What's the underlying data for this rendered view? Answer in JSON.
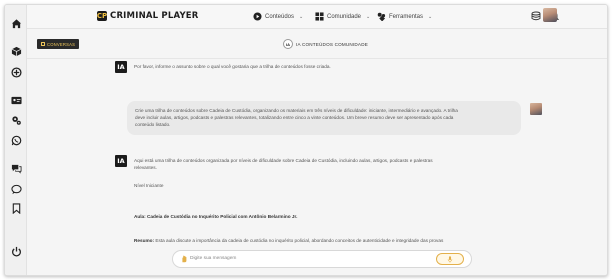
{
  "app": {
    "logo_text": "CRIMINAL PLAYER",
    "logo_mark": "CP"
  },
  "colors": {
    "accent": "#e3b04a",
    "dark": "#1b1b1b",
    "background": "#f5f5f5",
    "bubble": "#e9e9e9"
  },
  "topbar": {
    "nav": [
      {
        "label": "Conteúdos",
        "icon": "play-circle-icon"
      },
      {
        "label": "Comunidade",
        "icon": "grid-icon"
      },
      {
        "label": "Ferramentas",
        "icon": "tools-icon"
      }
    ],
    "icons": [
      "database-icon",
      "bell-icon"
    ]
  },
  "sidebar": {
    "icons": [
      "home-icon",
      "cube-icon",
      "layers-icon",
      "id-card-icon",
      "settings-icon",
      "whatsapp-icon",
      "chat-bubbles-icon",
      "comment-icon",
      "bookmark-icon",
      "power-icon"
    ]
  },
  "subbar": {
    "conversas_label": "CONVERSAS",
    "ia_badge": "IA",
    "title": "IA CONTEÚDOS COMUNIDADE"
  },
  "chat": {
    "ia_avatar": "IA",
    "ia_prompt": "Por favor, informe o assunto sobre o qual você gostaria que a trilha de conteúdos fosse criada.",
    "user_message_line1": "Crie uma trilha de conteúdos sobre Cadeia de Custódia, organizando os materiais em três níveis de dificuldade: iniciante, intermediário e avançado. A trilha",
    "user_message_line2": "deve incluir aulas, artigos, podcasts e palestras relevantes, totalizando entre cinco a vinte conteúdos. Um breve resumo deve ser apresentado após cada",
    "user_message_line3": "conteúdo listado.",
    "ia_reply_line1": "Aqui está uma trilha de conteúdos organizada por níveis de dificuldade sobre Cadeia de Custódia, incluindo aulas, artigos, podcasts e palestras",
    "ia_reply_line2": "relevantes.",
    "level_label": "Nível Iniciante",
    "aula_label": "Aula: Cadeia de Custódia no Inquérito Policial com Antônio Belarmino Jr.",
    "resumo_label": "Resumo:",
    "resumo_text": "Esta aula discute a importância da cadeia de custódia no inquérito policial, abordando conceitos de autenticidade e integridade das provas"
  },
  "input": {
    "placeholder": "Digite sua mensagem"
  }
}
